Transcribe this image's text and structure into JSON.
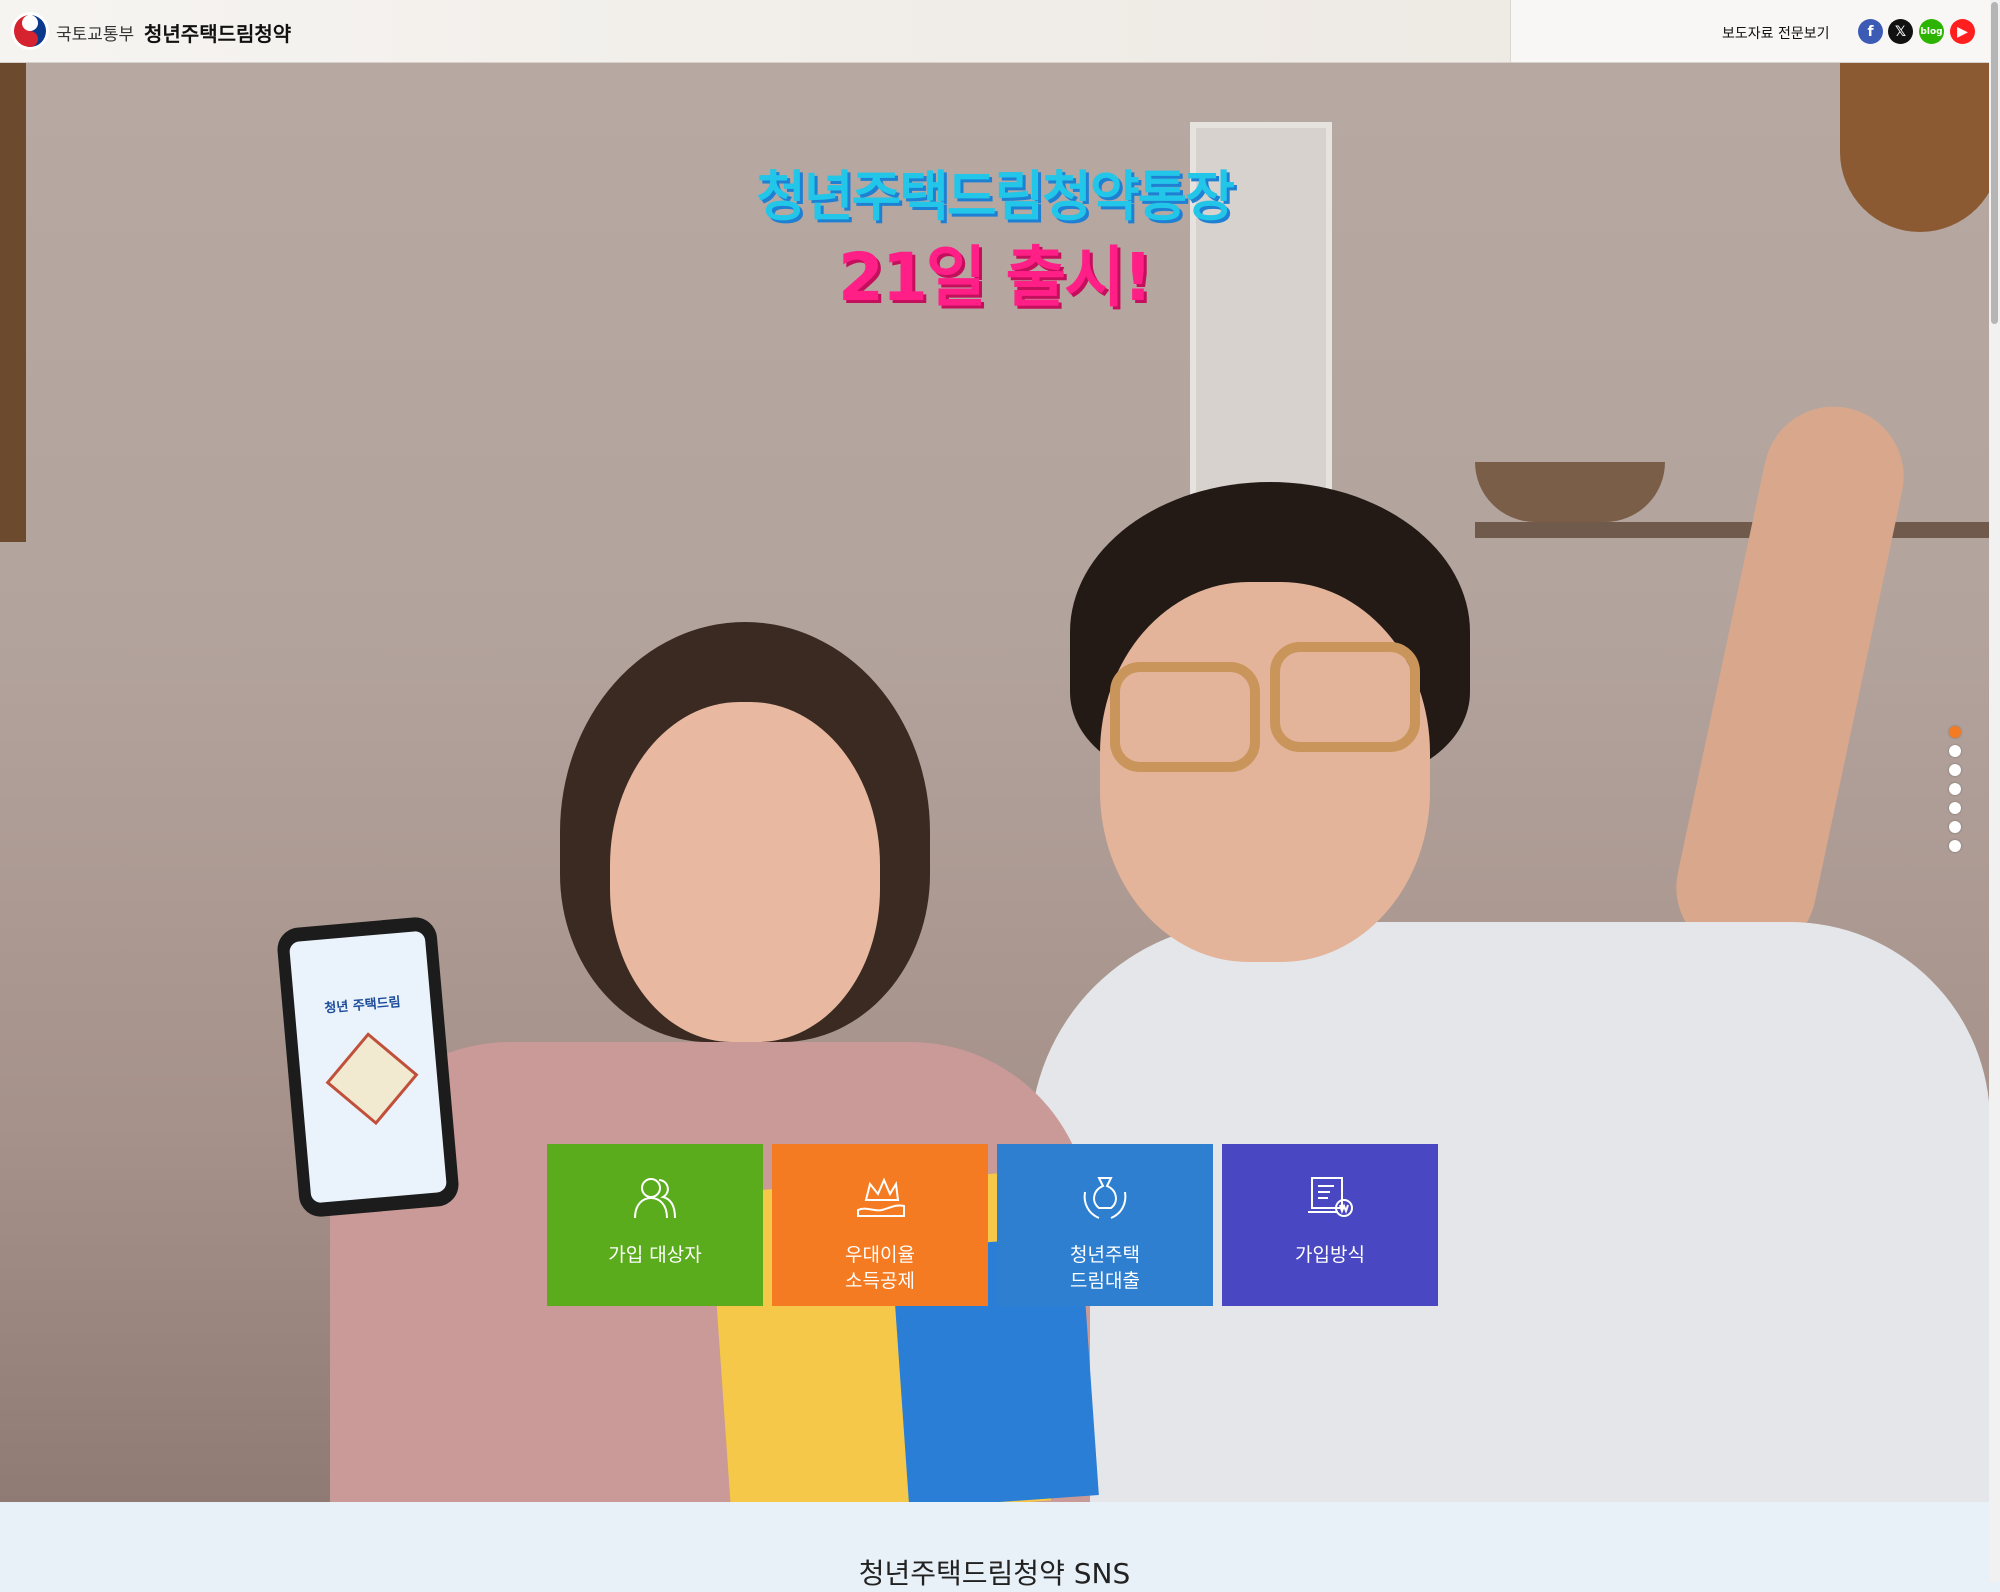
{
  "header": {
    "ministry": "국토교통부",
    "site_title": "청년주택드림청약",
    "press_link": "보도자료 전문보기",
    "sns_icons": [
      "facebook-icon",
      "x-icon",
      "blog-icon",
      "youtube-icon"
    ]
  },
  "hero": {
    "headline_line1": "청년주택드림청약통장",
    "headline_line2": "21일 출시!",
    "phone_screen_text": "청년 주택드림",
    "slide_count": 7,
    "active_slide": 1
  },
  "tiles": [
    {
      "label": "가입 대상자",
      "icon": "people-icon",
      "color": "#5aac1c"
    },
    {
      "label": "우대이율\n소득공제",
      "icon": "crown-hand-icon",
      "color": "#f47b22"
    },
    {
      "label": "청년주택\n드림대출",
      "icon": "money-bag-hands-icon",
      "color": "#2f7fd1"
    },
    {
      "label": "가입방식",
      "icon": "document-won-icon",
      "color": "#4a47c2"
    }
  ],
  "sns_section": {
    "title": "청년주택드림청약 SNS"
  },
  "colors": {
    "accent_orange": "#f47b22",
    "headline_cyan": "#22c6e8",
    "headline_pink": "#ff1f87"
  }
}
